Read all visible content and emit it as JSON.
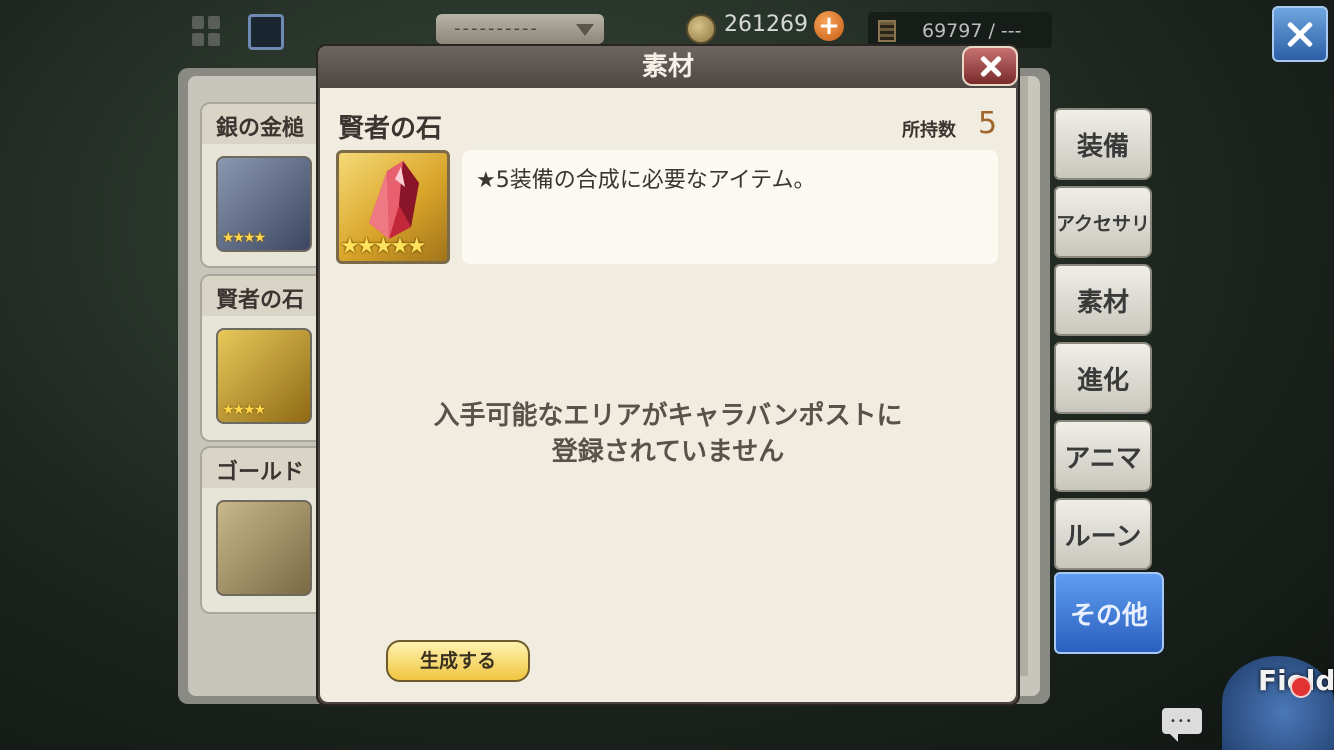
{
  "header": {
    "dropdown_value": "----------",
    "gold": "261269",
    "stamina": "69797 / ---"
  },
  "inventory": [
    {
      "name": "銀の金槌",
      "stars": "★★★★"
    },
    {
      "name": "賢者の石",
      "stars": "★★★★"
    },
    {
      "name": "ゴールド",
      "stars": ""
    }
  ],
  "side_tabs": [
    {
      "label": "装備"
    },
    {
      "label": "アクセサリ"
    },
    {
      "label": "素材"
    },
    {
      "label": "進化"
    },
    {
      "label": "アニマ"
    },
    {
      "label": "ルーン"
    },
    {
      "label": "その他"
    }
  ],
  "modal": {
    "title": "素材",
    "item_name": "賢者の石",
    "owned_label": "所持数",
    "owned_count": "5",
    "item_stars": "★★★★★",
    "description": "★5装備の合成に必要なアイテム。",
    "message_line1": "入手可能なエリアがキャラバンポストに",
    "message_line2": "登録されていません",
    "generate_button": "生成する"
  },
  "corner": {
    "field_label": "Field"
  },
  "colors": {
    "accent_blue": "#2a5fbf",
    "gold_button": "#f0c640",
    "close_red": "#7a2a2a",
    "owned_count": "#a0652a"
  }
}
